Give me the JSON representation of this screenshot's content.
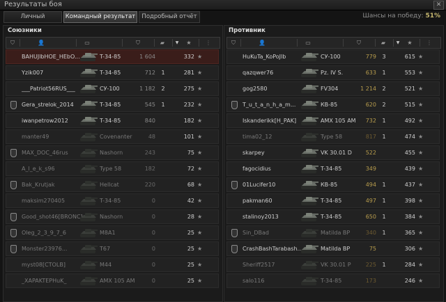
{
  "window": {
    "title": "Результаты боя",
    "close": "✕"
  },
  "tabs": [
    {
      "label": "Личный результат",
      "active": false
    },
    {
      "label": "Командный результат",
      "active": true
    },
    {
      "label": "Подробный отчёт",
      "active": false
    }
  ],
  "chance": {
    "label": "Шансы на победу:",
    "value": "51%"
  },
  "allies": {
    "title": "Союзники",
    "rows": [
      {
        "name": "BAHUJlbHOE_HEbO...",
        "tank": "T-34-85",
        "xp": "1 604",
        "kills": "",
        "score": "332",
        "state": "self",
        "badge": false
      },
      {
        "name": "Yzik007",
        "tank": "T-34-85",
        "xp": "712",
        "kills": "1",
        "score": "281",
        "state": "alive",
        "badge": false
      },
      {
        "name": "___Patriot56RUS___",
        "tank": "СУ-100",
        "xp": "1 182",
        "kills": "2",
        "score": "275",
        "state": "alive",
        "badge": false
      },
      {
        "name": "Gera_strelok_2014",
        "tank": "T-34-85",
        "xp": "545",
        "kills": "1",
        "score": "232",
        "state": "alive",
        "badge": true
      },
      {
        "name": "iwanpetrow2012",
        "tank": "T-34-85",
        "xp": "840",
        "kills": "",
        "score": "182",
        "state": "alive",
        "badge": false
      },
      {
        "name": "manter49",
        "tank": "Covenanter",
        "xp": "48",
        "kills": "",
        "score": "101",
        "state": "dead",
        "badge": false
      },
      {
        "name": "MAX_DOC_46rus",
        "tank": "Nashorn",
        "xp": "243",
        "kills": "",
        "score": "75",
        "state": "dead",
        "badge": true
      },
      {
        "name": "A_l_e_k_s96",
        "tank": "Type 58",
        "xp": "182",
        "kills": "",
        "score": "72",
        "state": "dead",
        "badge": false
      },
      {
        "name": "Bak_Krutjak",
        "tank": "Hellcat",
        "xp": "220",
        "kills": "",
        "score": "68",
        "state": "dead",
        "badge": true
      },
      {
        "name": "maksim270405",
        "tank": "T-34-85",
        "xp": "0",
        "kills": "",
        "score": "42",
        "state": "dead",
        "badge": false
      },
      {
        "name": "Good_shot46[BRONC]",
        "tank": "Nashorn",
        "xp": "0",
        "kills": "",
        "score": "28",
        "state": "dead",
        "badge": true
      },
      {
        "name": "Oleg_2_3_9_7_6",
        "tank": "M8A1",
        "xp": "0",
        "kills": "",
        "score": "25",
        "state": "dead",
        "badge": true
      },
      {
        "name": "Monster23976...",
        "tank": "T67",
        "xp": "0",
        "kills": "",
        "score": "25",
        "state": "dead",
        "badge": true
      },
      {
        "name": "myst08[CTOLB]",
        "tank": "M44",
        "xp": "0",
        "kills": "",
        "score": "25",
        "state": "dead",
        "badge": false
      },
      {
        "name": "_XAPAKTEPHuK_",
        "tank": "AMX 105 AM",
        "xp": "0",
        "kills": "",
        "score": "25",
        "state": "dead",
        "badge": false
      }
    ]
  },
  "enemies": {
    "title": "Противник",
    "rows": [
      {
        "name": "HuKuTa_KoPoJlb",
        "tank": "СУ-100",
        "xp": "779",
        "kills": "3",
        "score": "615",
        "state": "alive",
        "badge": false
      },
      {
        "name": "qazqwer76",
        "tank": "Pz. IV S.",
        "xp": "633",
        "kills": "1",
        "score": "553",
        "state": "alive",
        "badge": false
      },
      {
        "name": "gog2580",
        "tank": "FV304",
        "xp": "1 214",
        "kills": "2",
        "score": "521",
        "state": "alive",
        "badge": false
      },
      {
        "name": "T_u_t_a_n_h_a_m...",
        "tank": "КВ-85",
        "xp": "620",
        "kills": "2",
        "score": "515",
        "state": "alive",
        "badge": true
      },
      {
        "name": "Iskanderikk[H_PAK]",
        "tank": "AMX 105 AM",
        "xp": "732",
        "kills": "1",
        "score": "492",
        "state": "alive",
        "badge": false
      },
      {
        "name": "tima02_12",
        "tank": "Type 58",
        "xp": "817",
        "kills": "1",
        "score": "474",
        "state": "dead",
        "badge": false
      },
      {
        "name": "skarpey",
        "tank": "VK 30.01 D",
        "xp": "522",
        "kills": "",
        "score": "455",
        "state": "alive",
        "badge": false
      },
      {
        "name": "fagocidius",
        "tank": "T-34-85",
        "xp": "349",
        "kills": "",
        "score": "439",
        "state": "alive",
        "badge": false
      },
      {
        "name": "01Lucifer10",
        "tank": "КВ-85",
        "xp": "494",
        "kills": "1",
        "score": "437",
        "state": "alive",
        "badge": true
      },
      {
        "name": "pakman60",
        "tank": "T-34-85",
        "xp": "497",
        "kills": "1",
        "score": "398",
        "state": "alive",
        "badge": false
      },
      {
        "name": "stalinoy2013",
        "tank": "T-34-85",
        "xp": "650",
        "kills": "1",
        "score": "384",
        "state": "alive",
        "badge": false
      },
      {
        "name": "Sin_DBad",
        "tank": "Matilda BP",
        "xp": "340",
        "kills": "1",
        "score": "365",
        "state": "dead",
        "badge": true
      },
      {
        "name": "CrashBashTarabash...",
        "tank": "Matilda BP",
        "xp": "75",
        "kills": "",
        "score": "306",
        "state": "alive",
        "badge": true
      },
      {
        "name": "Sheriff2517",
        "tank": "VK 30.01 P",
        "xp": "225",
        "kills": "1",
        "score": "284",
        "state": "dead",
        "badge": false
      },
      {
        "name": "salo116",
        "tank": "T-34-85",
        "xp": "173",
        "kills": "",
        "score": "246",
        "state": "dead",
        "badge": false
      }
    ]
  },
  "icons": {
    "star": "★",
    "sort_arrow": "▼",
    "col_player": "player-icon",
    "col_xp": "xp-icon",
    "col_kills": "tank-kills-icon",
    "col_score": "star-icon"
  }
}
